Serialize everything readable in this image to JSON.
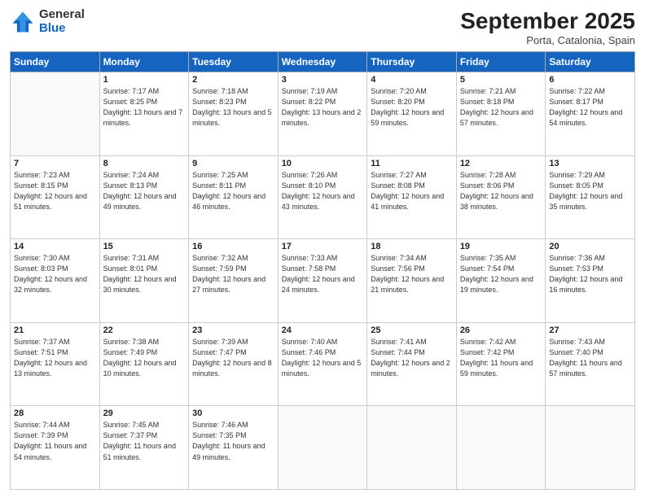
{
  "header": {
    "logo_general": "General",
    "logo_blue": "Blue",
    "title": "September 2025",
    "location": "Porta, Catalonia, Spain"
  },
  "columns": [
    "Sunday",
    "Monday",
    "Tuesday",
    "Wednesday",
    "Thursday",
    "Friday",
    "Saturday"
  ],
  "weeks": [
    [
      {
        "day": "",
        "sunrise": "",
        "sunset": "",
        "daylight": ""
      },
      {
        "day": "1",
        "sunrise": "Sunrise: 7:17 AM",
        "sunset": "Sunset: 8:25 PM",
        "daylight": "Daylight: 13 hours and 7 minutes."
      },
      {
        "day": "2",
        "sunrise": "Sunrise: 7:18 AM",
        "sunset": "Sunset: 8:23 PM",
        "daylight": "Daylight: 13 hours and 5 minutes."
      },
      {
        "day": "3",
        "sunrise": "Sunrise: 7:19 AM",
        "sunset": "Sunset: 8:22 PM",
        "daylight": "Daylight: 13 hours and 2 minutes."
      },
      {
        "day": "4",
        "sunrise": "Sunrise: 7:20 AM",
        "sunset": "Sunset: 8:20 PM",
        "daylight": "Daylight: 12 hours and 59 minutes."
      },
      {
        "day": "5",
        "sunrise": "Sunrise: 7:21 AM",
        "sunset": "Sunset: 8:18 PM",
        "daylight": "Daylight: 12 hours and 57 minutes."
      },
      {
        "day": "6",
        "sunrise": "Sunrise: 7:22 AM",
        "sunset": "Sunset: 8:17 PM",
        "daylight": "Daylight: 12 hours and 54 minutes."
      }
    ],
    [
      {
        "day": "7",
        "sunrise": "Sunrise: 7:23 AM",
        "sunset": "Sunset: 8:15 PM",
        "daylight": "Daylight: 12 hours and 51 minutes."
      },
      {
        "day": "8",
        "sunrise": "Sunrise: 7:24 AM",
        "sunset": "Sunset: 8:13 PM",
        "daylight": "Daylight: 12 hours and 49 minutes."
      },
      {
        "day": "9",
        "sunrise": "Sunrise: 7:25 AM",
        "sunset": "Sunset: 8:11 PM",
        "daylight": "Daylight: 12 hours and 46 minutes."
      },
      {
        "day": "10",
        "sunrise": "Sunrise: 7:26 AM",
        "sunset": "Sunset: 8:10 PM",
        "daylight": "Daylight: 12 hours and 43 minutes."
      },
      {
        "day": "11",
        "sunrise": "Sunrise: 7:27 AM",
        "sunset": "Sunset: 8:08 PM",
        "daylight": "Daylight: 12 hours and 41 minutes."
      },
      {
        "day": "12",
        "sunrise": "Sunrise: 7:28 AM",
        "sunset": "Sunset: 8:06 PM",
        "daylight": "Daylight: 12 hours and 38 minutes."
      },
      {
        "day": "13",
        "sunrise": "Sunrise: 7:29 AM",
        "sunset": "Sunset: 8:05 PM",
        "daylight": "Daylight: 12 hours and 35 minutes."
      }
    ],
    [
      {
        "day": "14",
        "sunrise": "Sunrise: 7:30 AM",
        "sunset": "Sunset: 8:03 PM",
        "daylight": "Daylight: 12 hours and 32 minutes."
      },
      {
        "day": "15",
        "sunrise": "Sunrise: 7:31 AM",
        "sunset": "Sunset: 8:01 PM",
        "daylight": "Daylight: 12 hours and 30 minutes."
      },
      {
        "day": "16",
        "sunrise": "Sunrise: 7:32 AM",
        "sunset": "Sunset: 7:59 PM",
        "daylight": "Daylight: 12 hours and 27 minutes."
      },
      {
        "day": "17",
        "sunrise": "Sunrise: 7:33 AM",
        "sunset": "Sunset: 7:58 PM",
        "daylight": "Daylight: 12 hours and 24 minutes."
      },
      {
        "day": "18",
        "sunrise": "Sunrise: 7:34 AM",
        "sunset": "Sunset: 7:56 PM",
        "daylight": "Daylight: 12 hours and 21 minutes."
      },
      {
        "day": "19",
        "sunrise": "Sunrise: 7:35 AM",
        "sunset": "Sunset: 7:54 PM",
        "daylight": "Daylight: 12 hours and 19 minutes."
      },
      {
        "day": "20",
        "sunrise": "Sunrise: 7:36 AM",
        "sunset": "Sunset: 7:53 PM",
        "daylight": "Daylight: 12 hours and 16 minutes."
      }
    ],
    [
      {
        "day": "21",
        "sunrise": "Sunrise: 7:37 AM",
        "sunset": "Sunset: 7:51 PM",
        "daylight": "Daylight: 12 hours and 13 minutes."
      },
      {
        "day": "22",
        "sunrise": "Sunrise: 7:38 AM",
        "sunset": "Sunset: 7:49 PM",
        "daylight": "Daylight: 12 hours and 10 minutes."
      },
      {
        "day": "23",
        "sunrise": "Sunrise: 7:39 AM",
        "sunset": "Sunset: 7:47 PM",
        "daylight": "Daylight: 12 hours and 8 minutes."
      },
      {
        "day": "24",
        "sunrise": "Sunrise: 7:40 AM",
        "sunset": "Sunset: 7:46 PM",
        "daylight": "Daylight: 12 hours and 5 minutes."
      },
      {
        "day": "25",
        "sunrise": "Sunrise: 7:41 AM",
        "sunset": "Sunset: 7:44 PM",
        "daylight": "Daylight: 12 hours and 2 minutes."
      },
      {
        "day": "26",
        "sunrise": "Sunrise: 7:42 AM",
        "sunset": "Sunset: 7:42 PM",
        "daylight": "Daylight: 11 hours and 59 minutes."
      },
      {
        "day": "27",
        "sunrise": "Sunrise: 7:43 AM",
        "sunset": "Sunset: 7:40 PM",
        "daylight": "Daylight: 11 hours and 57 minutes."
      }
    ],
    [
      {
        "day": "28",
        "sunrise": "Sunrise: 7:44 AM",
        "sunset": "Sunset: 7:39 PM",
        "daylight": "Daylight: 11 hours and 54 minutes."
      },
      {
        "day": "29",
        "sunrise": "Sunrise: 7:45 AM",
        "sunset": "Sunset: 7:37 PM",
        "daylight": "Daylight: 11 hours and 51 minutes."
      },
      {
        "day": "30",
        "sunrise": "Sunrise: 7:46 AM",
        "sunset": "Sunset: 7:35 PM",
        "daylight": "Daylight: 11 hours and 49 minutes."
      },
      {
        "day": "",
        "sunrise": "",
        "sunset": "",
        "daylight": ""
      },
      {
        "day": "",
        "sunrise": "",
        "sunset": "",
        "daylight": ""
      },
      {
        "day": "",
        "sunrise": "",
        "sunset": "",
        "daylight": ""
      },
      {
        "day": "",
        "sunrise": "",
        "sunset": "",
        "daylight": ""
      }
    ]
  ]
}
